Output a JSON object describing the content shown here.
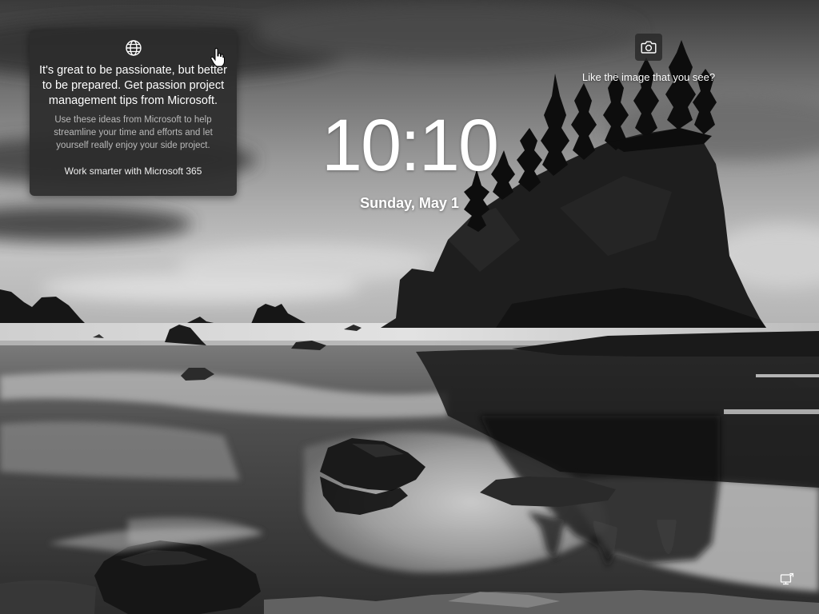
{
  "spotlight": {
    "headline": "It's great to be passionate, but better to be prepared. Get passion project management tips from Microsoft.",
    "body": "Use these ideas from Microsoft to help streamline your time and efforts and let yourself really enjoy your side project.",
    "cta": "Work smarter with Microsoft 365",
    "icon": "globe-icon"
  },
  "camera": {
    "icon": "camera-icon",
    "prompt": "Like the image that you see?"
  },
  "clock": {
    "time": "10:10",
    "date": "Sunday, May 1"
  },
  "status": {
    "icon": "network-icon"
  },
  "colors": {
    "card_bg": "#2c2c2c",
    "text_primary": "#ffffff",
    "text_secondary": "#b9b9b9"
  }
}
